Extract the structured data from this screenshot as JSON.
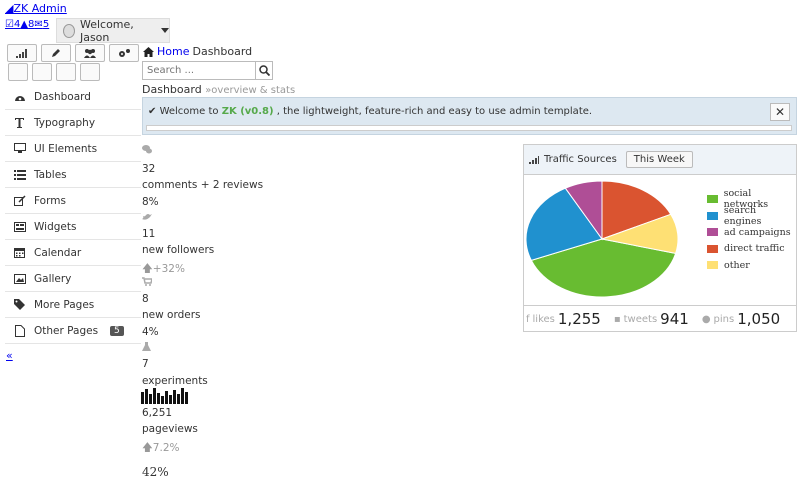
{
  "header": {
    "brand": "ZK Admin",
    "notifications": {
      "tasks": "4",
      "alerts": "8",
      "messages": "5"
    },
    "welcome": "Welcome, Jason"
  },
  "sidebar": {
    "items": [
      {
        "label": "Dashboard",
        "icon": "dashboard-icon"
      },
      {
        "label": "Typography",
        "icon": "text-icon"
      },
      {
        "label": "UI Elements",
        "icon": "desktop-icon"
      },
      {
        "label": "Tables",
        "icon": "list-icon"
      },
      {
        "label": "Forms",
        "icon": "edit-icon"
      },
      {
        "label": "Widgets",
        "icon": "widgets-icon"
      },
      {
        "label": "Calendar",
        "icon": "calendar-icon"
      },
      {
        "label": "Gallery",
        "icon": "image-icon"
      },
      {
        "label": "More Pages",
        "icon": "tag-icon"
      },
      {
        "label": "Other Pages",
        "icon": "file-icon",
        "badge": "5"
      }
    ],
    "collapse": "«"
  },
  "breadcrumb": {
    "home": "Home",
    "current": "Dashboard"
  },
  "search": {
    "placeholder": "Search ..."
  },
  "page_header": {
    "title": "Dashboard",
    "subtitle": "»overview & stats"
  },
  "alert": {
    "pre": "Welcome to ",
    "brand": "ZK (v0.8)",
    "post": " , the lightweight, feature-rich and easy to use admin template."
  },
  "stats": [
    {
      "value": "32",
      "label": "comments + 2 reviews",
      "change": "8%"
    },
    {
      "value": "11",
      "label": "new followers",
      "change": "+32%"
    },
    {
      "value": "8",
      "label": "new orders",
      "change": "4%"
    },
    {
      "value": "7",
      "label": "experiments"
    },
    {
      "value": "6,251",
      "label": "pageviews",
      "change": "7.2%"
    },
    {
      "value": "42%"
    }
  ],
  "traffic": {
    "title": "Traffic Sources",
    "period_button": "This Week",
    "footer": [
      {
        "label": "likes",
        "value": "1,255"
      },
      {
        "label": "tweets",
        "value": "941"
      },
      {
        "label": "pins",
        "value": "1,050"
      }
    ]
  },
  "chart_data": {
    "type": "pie",
    "categories": [
      "social networks",
      "search engines",
      "ad campaigns",
      "direct traffic",
      "other"
    ],
    "values": [
      40,
      23,
      8,
      18,
      11
    ],
    "colors": [
      "#68bc31",
      "#2091cf",
      "#af4e96",
      "#da5430",
      "#fee074"
    ]
  }
}
